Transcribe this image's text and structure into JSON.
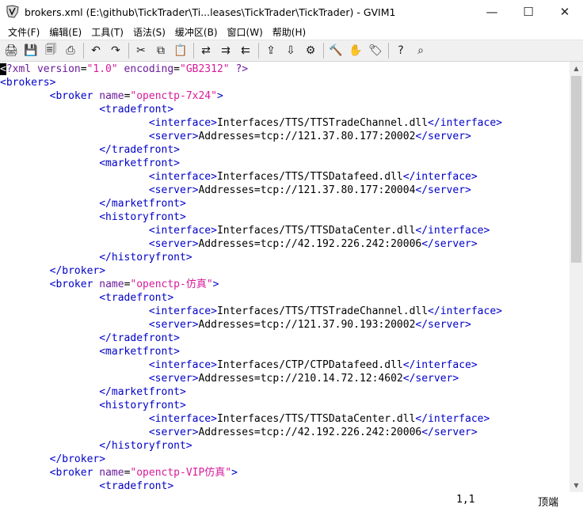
{
  "window": {
    "title": "brokers.xml (E:\\github\\TickTrader\\Ti...leases\\TickTrader\\TickTrader) - GVIM1",
    "controls": {
      "minimize": "—",
      "maximize": "☐",
      "close": "✕"
    }
  },
  "menu": [
    "文件(F)",
    "编辑(E)",
    "工具(T)",
    "语法(S)",
    "缓冲区(B)",
    "窗口(W)",
    "帮助(H)"
  ],
  "toolbar": {
    "groups": [
      [
        "open-icon",
        "save-icon",
        "save-all-icon",
        "print-icon"
      ],
      [
        "undo-icon",
        "redo-icon"
      ],
      [
        "cut-icon",
        "copy-icon",
        "paste-icon"
      ],
      [
        "find-replace-icon",
        "find-next-icon",
        "find-prev-icon"
      ],
      [
        "load-session-icon",
        "save-session-icon",
        "run-script-icon"
      ],
      [
        "make-icon",
        "shell-icon",
        "tag-jump-icon"
      ],
      [
        "help-icon",
        "find-help-icon"
      ]
    ],
    "glyphs": {
      "open-icon": "🖨",
      "save-icon": "💾",
      "save-all-icon": "🗐",
      "print-icon": "⎙",
      "undo-icon": "↶",
      "redo-icon": "↷",
      "cut-icon": "✂",
      "copy-icon": "⧉",
      "paste-icon": "📋",
      "find-replace-icon": "⇄",
      "find-next-icon": "⇉",
      "find-prev-icon": "⇇",
      "load-session-icon": "⇪",
      "save-session-icon": "⇩",
      "run-script-icon": "⚙",
      "make-icon": "🔨",
      "shell-icon": "✋",
      "tag-jump-icon": "🏷",
      "help-icon": "?",
      "find-help-icon": "⌕"
    }
  },
  "editor": {
    "lines": [
      [
        [
          "cursor",
          "<"
        ],
        [
          "attr",
          "?xml version"
        ],
        [
          "txt",
          "="
        ],
        [
          "str",
          "\"1.0\""
        ],
        [
          "txt",
          " "
        ],
        [
          "attr",
          "encoding"
        ],
        [
          "txt",
          "="
        ],
        [
          "str",
          "\"GB2312\""
        ],
        [
          "txt",
          " "
        ],
        [
          "attr",
          "?>"
        ]
      ],
      [
        [
          "tag",
          "<brokers>"
        ]
      ],
      [
        [
          "txt",
          "        "
        ],
        [
          "tag",
          "<broker "
        ],
        [
          "attr",
          "name"
        ],
        [
          "txt",
          "="
        ],
        [
          "str",
          "\"openctp-7x24\""
        ],
        [
          "tag",
          ">"
        ]
      ],
      [
        [
          "txt",
          "                "
        ],
        [
          "tag",
          "<tradefront>"
        ]
      ],
      [
        [
          "txt",
          "                        "
        ],
        [
          "tag",
          "<interface>"
        ],
        [
          "txt",
          "Interfaces/TTS/TTSTradeChannel.dll"
        ],
        [
          "tag",
          "</interface>"
        ]
      ],
      [
        [
          "txt",
          "                        "
        ],
        [
          "tag",
          "<server>"
        ],
        [
          "txt",
          "Addresses=tcp://121.37.80.177:20002"
        ],
        [
          "tag",
          "</server>"
        ]
      ],
      [
        [
          "txt",
          "                "
        ],
        [
          "tag",
          "</tradefront>"
        ]
      ],
      [
        [
          "txt",
          "                "
        ],
        [
          "tag",
          "<marketfront>"
        ]
      ],
      [
        [
          "txt",
          "                        "
        ],
        [
          "tag",
          "<interface>"
        ],
        [
          "txt",
          "Interfaces/TTS/TTSDatafeed.dll"
        ],
        [
          "tag",
          "</interface>"
        ]
      ],
      [
        [
          "txt",
          "                        "
        ],
        [
          "tag",
          "<server>"
        ],
        [
          "txt",
          "Addresses=tcp://121.37.80.177:20004"
        ],
        [
          "tag",
          "</server>"
        ]
      ],
      [
        [
          "txt",
          "                "
        ],
        [
          "tag",
          "</marketfront>"
        ]
      ],
      [
        [
          "txt",
          "                "
        ],
        [
          "tag",
          "<historyfront>"
        ]
      ],
      [
        [
          "txt",
          "                        "
        ],
        [
          "tag",
          "<interface>"
        ],
        [
          "txt",
          "Interfaces/TTS/TTSDataCenter.dll"
        ],
        [
          "tag",
          "</interface>"
        ]
      ],
      [
        [
          "txt",
          "                        "
        ],
        [
          "tag",
          "<server>"
        ],
        [
          "txt",
          "Addresses=tcp://42.192.226.242:20006"
        ],
        [
          "tag",
          "</server>"
        ]
      ],
      [
        [
          "txt",
          "                "
        ],
        [
          "tag",
          "</historyfront>"
        ]
      ],
      [
        [
          "txt",
          "        "
        ],
        [
          "tag",
          "</broker>"
        ]
      ],
      [
        [
          "txt",
          "        "
        ],
        [
          "tag",
          "<broker "
        ],
        [
          "attr",
          "name"
        ],
        [
          "txt",
          "="
        ],
        [
          "str",
          "\"openctp-仿真\""
        ],
        [
          "tag",
          ">"
        ]
      ],
      [
        [
          "txt",
          "                "
        ],
        [
          "tag",
          "<tradefront>"
        ]
      ],
      [
        [
          "txt",
          "                        "
        ],
        [
          "tag",
          "<interface>"
        ],
        [
          "txt",
          "Interfaces/TTS/TTSTradeChannel.dll"
        ],
        [
          "tag",
          "</interface>"
        ]
      ],
      [
        [
          "txt",
          "                        "
        ],
        [
          "tag",
          "<server>"
        ],
        [
          "txt",
          "Addresses=tcp://121.37.90.193:20002"
        ],
        [
          "tag",
          "</server>"
        ]
      ],
      [
        [
          "txt",
          "                "
        ],
        [
          "tag",
          "</tradefront>"
        ]
      ],
      [
        [
          "txt",
          "                "
        ],
        [
          "tag",
          "<marketfront>"
        ]
      ],
      [
        [
          "txt",
          "                        "
        ],
        [
          "tag",
          "<interface>"
        ],
        [
          "txt",
          "Interfaces/CTP/CTPDatafeed.dll"
        ],
        [
          "tag",
          "</interface>"
        ]
      ],
      [
        [
          "txt",
          "                        "
        ],
        [
          "tag",
          "<server>"
        ],
        [
          "txt",
          "Addresses=tcp://210.14.72.12:4602"
        ],
        [
          "tag",
          "</server>"
        ]
      ],
      [
        [
          "txt",
          "                "
        ],
        [
          "tag",
          "</marketfront>"
        ]
      ],
      [
        [
          "txt",
          "                "
        ],
        [
          "tag",
          "<historyfront>"
        ]
      ],
      [
        [
          "txt",
          "                        "
        ],
        [
          "tag",
          "<interface>"
        ],
        [
          "txt",
          "Interfaces/TTS/TTSDataCenter.dll"
        ],
        [
          "tag",
          "</interface>"
        ]
      ],
      [
        [
          "txt",
          "                        "
        ],
        [
          "tag",
          "<server>"
        ],
        [
          "txt",
          "Addresses=tcp://42.192.226.242:20006"
        ],
        [
          "tag",
          "</server>"
        ]
      ],
      [
        [
          "txt",
          "                "
        ],
        [
          "tag",
          "</historyfront>"
        ]
      ],
      [
        [
          "txt",
          "        "
        ],
        [
          "tag",
          "</broker>"
        ]
      ],
      [
        [
          "txt",
          "        "
        ],
        [
          "tag",
          "<broker "
        ],
        [
          "attr",
          "name"
        ],
        [
          "txt",
          "="
        ],
        [
          "str",
          "\"openctp-VIP仿真\""
        ],
        [
          "tag",
          ">"
        ]
      ],
      [
        [
          "txt",
          "                "
        ],
        [
          "tag",
          "<tradefront>"
        ]
      ]
    ]
  },
  "statusbar": {
    "position": "1,1",
    "scroll": "顶端"
  },
  "colors": {
    "tag": "#0000c8",
    "attr": "#6a1b9a",
    "string": "#d81b9a",
    "text": "#000000"
  }
}
